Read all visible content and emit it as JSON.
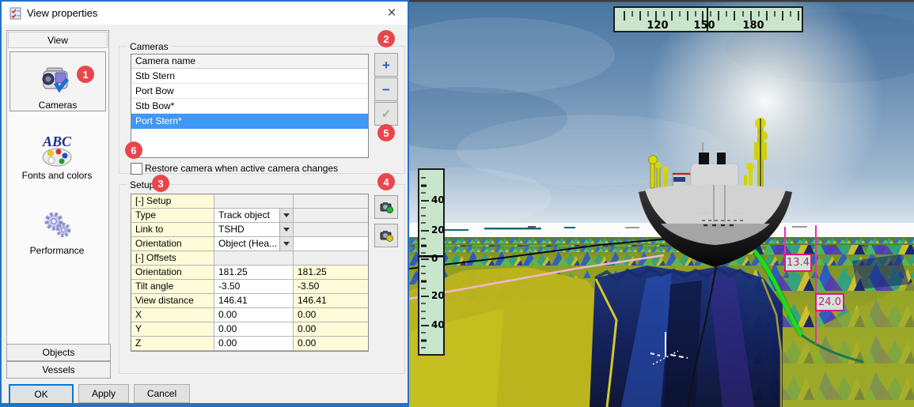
{
  "dialog": {
    "title": "View properties",
    "callouts": [
      "1",
      "2",
      "3",
      "4",
      "5",
      "6"
    ],
    "sidebar": {
      "tab": "View",
      "abc_text": "ABC",
      "items": [
        {
          "label": "Cameras"
        },
        {
          "label": "Fonts and colors"
        },
        {
          "label": "Performance"
        }
      ],
      "bottom_tabs": [
        {
          "label": "Objects"
        },
        {
          "label": "Vessels"
        }
      ]
    },
    "cameras": {
      "group_label": "Cameras",
      "column_header": "Camera name",
      "rows": [
        {
          "name": "Stb Stern",
          "selected": false
        },
        {
          "name": "Port Bow",
          "selected": false
        },
        {
          "name": "Stb Bow*",
          "selected": false
        },
        {
          "name": "Port Stern*",
          "selected": true
        }
      ],
      "add_label": "+",
      "remove_label": "−",
      "accept_label": "✓"
    },
    "restore_checkbox": {
      "label": "Restore camera when active camera changes",
      "checked": false
    },
    "setup": {
      "group_label": "Setup",
      "rows": [
        {
          "label": "[-] Setup",
          "kind": "section",
          "v1": "",
          "v2": ""
        },
        {
          "label": "Type",
          "kind": "dropdown",
          "v1": "Track object",
          "v2": ""
        },
        {
          "label": "Link to",
          "kind": "dropdown",
          "v1": "TSHD",
          "v2": ""
        },
        {
          "label": "Orientation",
          "kind": "dropdown",
          "v1": "Object (Hea...",
          "v2": ""
        },
        {
          "label": "[-] Offsets",
          "kind": "section",
          "v1": "",
          "v2": ""
        },
        {
          "label": "Orientation",
          "kind": "value",
          "v1": "181.25",
          "v2": "181.25"
        },
        {
          "label": "Tilt angle",
          "kind": "value",
          "v1": "-3.50",
          "v2": "-3.50"
        },
        {
          "label": "View distance",
          "kind": "value",
          "v1": "146.41",
          "v2": "146.41"
        },
        {
          "label": "X",
          "kind": "value",
          "v1": "0.00",
          "v2": "0.00"
        },
        {
          "label": "Y",
          "kind": "value",
          "v1": "0.00",
          "v2": "0.00"
        },
        {
          "label": "Z",
          "kind": "value",
          "v1": "0.00",
          "v2": "0.00"
        }
      ]
    },
    "buttons": {
      "ok": "OK",
      "apply": "Apply",
      "cancel": "Cancel"
    }
  },
  "viewport": {
    "heading_ruler": {
      "labels": [
        "120",
        "150",
        "180"
      ]
    },
    "depth_scale": {
      "labels": [
        "40",
        "20",
        "0",
        "20",
        "40"
      ]
    },
    "depth_annotations": [
      {
        "value": "13.4"
      },
      {
        "value": "24.0"
      }
    ]
  },
  "colors": {
    "accent_blue": "#0078d7",
    "selection_blue": "#3d99f5",
    "badge_red": "#e8464d",
    "ruler_green": "#c9e6cd",
    "annotation_magenta": "#e0148c"
  }
}
